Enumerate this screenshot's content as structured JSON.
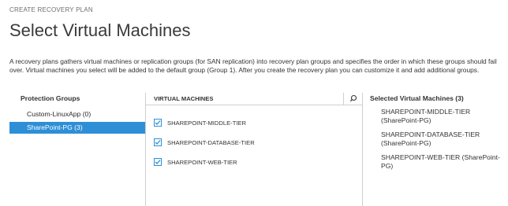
{
  "breadcrumb": "CREATE RECOVERY PLAN",
  "page_title": "Select Virtual Machines",
  "description": "A recovery plans gathers virtual machines or replication groups (for SAN replication) into recovery plan groups and specifies the order in which these groups should fail over. Virtual machines you select will be added to the default group (Group 1). After you create the recovery plan you can customize it and add additional groups.",
  "protection_groups": {
    "header": "Protection Groups",
    "items": [
      {
        "label": "Custom-LinuxApp (0)",
        "selected": false
      },
      {
        "label": "SharePoint-PG (3)",
        "selected": true
      }
    ]
  },
  "virtual_machines": {
    "header": "VIRTUAL MACHINES",
    "search_icon": "search-icon",
    "items": [
      {
        "label": "SHAREPOINT-MIDDLE-TIER",
        "checked": true
      },
      {
        "label": "SHAREPOINT-DATABASE-TIER",
        "checked": true
      },
      {
        "label": "SHAREPOINT-WEB-TIER",
        "checked": true
      }
    ]
  },
  "selected_vms": {
    "header": "Selected Virtual Machines (3)",
    "items": [
      {
        "label": "SHAREPOINT-MIDDLE-TIER (SharePoint-PG)"
      },
      {
        "label": "SHAREPOINT-DATABASE-TIER (SharePoint-PG)"
      },
      {
        "label": "SHAREPOINT-WEB-TIER (SharePoint-PG)"
      }
    ]
  },
  "colors": {
    "accent": "#2e8fd7",
    "selected_text": "#ffffff",
    "border": "#cfcfcf"
  }
}
